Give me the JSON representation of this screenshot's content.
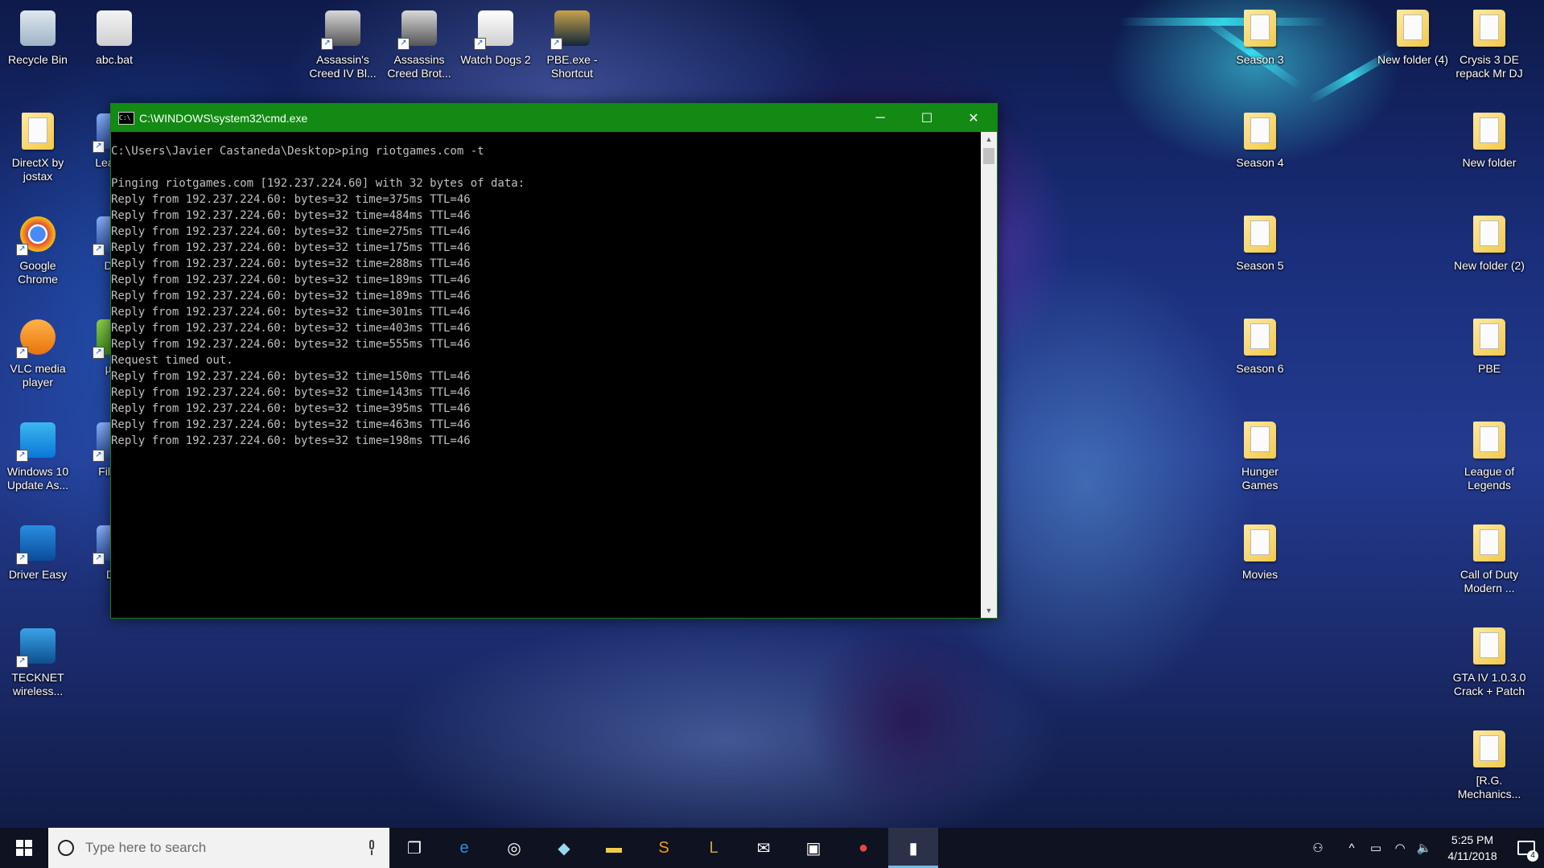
{
  "desktop": {
    "icons_left": [
      {
        "label": "Recycle Bin",
        "icon": "recycle-bin-icon"
      },
      {
        "label": "abc.bat",
        "icon": "batch-file-icon"
      },
      {
        "label": "DirectX by jostax",
        "icon": "folder-icon"
      },
      {
        "label": "Lea Dis",
        "icon": "app-shortcut-icon"
      },
      {
        "label": "Google Chrome",
        "icon": "chrome-icon"
      },
      {
        "label": "Dev",
        "icon": "app-shortcut-icon"
      },
      {
        "label": "VLC media player",
        "icon": "vlc-icon"
      },
      {
        "label": "µTo",
        "icon": "utorrent-icon"
      },
      {
        "label": "Windows 10 Update As...",
        "icon": "windows-logo-icon"
      },
      {
        "label": "File Cl",
        "icon": "app-shortcut-icon"
      },
      {
        "label": "Driver Easy",
        "icon": "driver-easy-icon"
      },
      {
        "label": "Dis",
        "icon": "app-shortcut-icon"
      },
      {
        "label": "TECKNET wireless...",
        "icon": "tecknet-icon"
      }
    ],
    "icons_top": [
      {
        "label": "Assassin's Creed IV Bl...",
        "icon": "assassins-creed-icon"
      },
      {
        "label": "Assassins Creed Brot...",
        "icon": "assassins-creed-icon"
      },
      {
        "label": "Watch Dogs 2",
        "icon": "watch-dogs-icon"
      },
      {
        "label": "PBE.exe - Shortcut",
        "icon": "league-of-legends-icon"
      }
    ],
    "icons_right_col1": [
      {
        "label": "Season 3",
        "icon": "folder-icon"
      },
      {
        "label": "Season 4",
        "icon": "folder-icon"
      },
      {
        "label": "Season 5",
        "icon": "folder-icon"
      },
      {
        "label": "Season 6",
        "icon": "folder-icon"
      },
      {
        "label": "Hunger Games",
        "icon": "folder-icon"
      },
      {
        "label": "Movies",
        "icon": "folder-icon"
      }
    ],
    "icons_right_col2": [
      {
        "label": "New folder (4)",
        "icon": "folder-icon"
      },
      {
        "label": "Crysis 3 DE repack Mr DJ",
        "icon": "folder-icon"
      },
      {
        "label": "New folder",
        "icon": "folder-icon"
      },
      {
        "label": "New folder (2)",
        "icon": "folder-icon"
      },
      {
        "label": "PBE",
        "icon": "folder-icon"
      },
      {
        "label": "League of Legends",
        "icon": "folder-icon"
      },
      {
        "label": "Call of Duty Modern ...",
        "icon": "folder-icon"
      },
      {
        "label": "GTA IV 1.0.3.0 Crack + Patch",
        "icon": "folder-icon"
      },
      {
        "label": "[R.G. Mechanics...",
        "icon": "folder-icon"
      }
    ]
  },
  "cmd": {
    "title": "C:\\WINDOWS\\system32\\cmd.exe",
    "title_bar_color": "#138a13",
    "icon_text": "C:\\",
    "lines": [
      "C:\\Users\\Javier Castaneda\\Desktop>ping riotgames.com -t",
      "",
      "Pinging riotgames.com [192.237.224.60] with 32 bytes of data:",
      "Reply from 192.237.224.60: bytes=32 time=375ms TTL=46",
      "Reply from 192.237.224.60: bytes=32 time=484ms TTL=46",
      "Reply from 192.237.224.60: bytes=32 time=275ms TTL=46",
      "Reply from 192.237.224.60: bytes=32 time=175ms TTL=46",
      "Reply from 192.237.224.60: bytes=32 time=288ms TTL=46",
      "Reply from 192.237.224.60: bytes=32 time=189ms TTL=46",
      "Reply from 192.237.224.60: bytes=32 time=189ms TTL=46",
      "Reply from 192.237.224.60: bytes=32 time=301ms TTL=46",
      "Reply from 192.237.224.60: bytes=32 time=403ms TTL=46",
      "Reply from 192.237.224.60: bytes=32 time=555ms TTL=46",
      "Request timed out.",
      "Reply from 192.237.224.60: bytes=32 time=150ms TTL=46",
      "Reply from 192.237.224.60: bytes=32 time=143ms TTL=46",
      "Reply from 192.237.224.60: bytes=32 time=395ms TTL=46",
      "Reply from 192.237.224.60: bytes=32 time=463ms TTL=46",
      "Reply from 192.237.224.60: bytes=32 time=198ms TTL=46"
    ],
    "minimize_glyph": "─",
    "maximize_glyph": "☐",
    "close_glyph": "✕"
  },
  "taskbar": {
    "search_placeholder": "Type here to search",
    "apps": [
      {
        "name": "task-view-icon",
        "glyph": "❐",
        "active": false
      },
      {
        "name": "edge-icon",
        "glyph": "e",
        "color": "#2f8fe0",
        "active": false
      },
      {
        "name": "groove-music-icon",
        "glyph": "◎",
        "active": false
      },
      {
        "name": "app-tile-icon",
        "glyph": "◆",
        "color": "#9ad8f0",
        "active": false
      },
      {
        "name": "file-explorer-icon",
        "glyph": "▬",
        "color": "#f3c94a",
        "active": false
      },
      {
        "name": "sublime-text-icon",
        "glyph": "S",
        "color": "#f89a1c",
        "active": false
      },
      {
        "name": "league-of-legends-icon",
        "glyph": "L",
        "color": "#c8a24a",
        "active": false
      },
      {
        "name": "mail-icon",
        "glyph": "✉",
        "active": false
      },
      {
        "name": "store-icon",
        "glyph": "▣",
        "active": false
      },
      {
        "name": "chrome-icon",
        "glyph": "●",
        "color": "#e44b3a",
        "active": false
      },
      {
        "name": "cmd-icon",
        "glyph": "▮",
        "active": true
      }
    ],
    "tray": {
      "people_glyph": "⚇",
      "chevron_glyph": "^",
      "battery_glyph": "▭",
      "wifi_glyph": "◠",
      "volume_glyph": "🔈",
      "time": "5:25 PM",
      "date": "4/11/2018",
      "notification_count": "4"
    }
  }
}
